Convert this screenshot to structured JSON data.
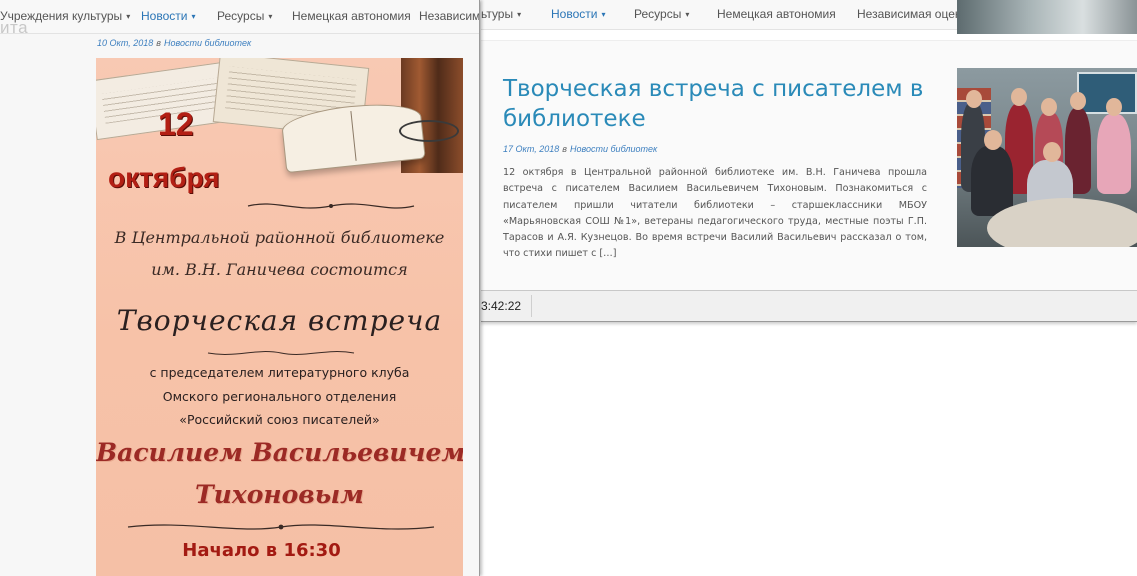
{
  "left_window": {
    "nav": [
      {
        "label": "Учреждения культуры",
        "caret": "▾",
        "active": false
      },
      {
        "label": "Новости",
        "caret": "▾",
        "active": true
      },
      {
        "label": "Ресурсы",
        "caret": "▾",
        "active": false
      },
      {
        "label": "Немецкая автономия",
        "caret": "",
        "active": false
      },
      {
        "label": "Независим",
        "caret": "",
        "active": false
      }
    ],
    "ghost_text": "ита",
    "post_meta": {
      "date": "10 Окт, 2018",
      "sep": "в",
      "category": "Новости библиотек"
    },
    "poster": {
      "day": "12",
      "month": "октября",
      "line1": "В Центральной районной библиотеке",
      "line2": "им. В.Н. Ганичева состоится",
      "title": "Творческая встреча",
      "sub1": "с председателем литературного клуба",
      "sub2": "Омского регионального отделения",
      "sub3": "«Российский союз писателей»",
      "name1": "Василием Васильевичем",
      "name2": "Тихоновым",
      "start": "Начало в 16:30"
    }
  },
  "right_window": {
    "nav": [
      {
        "label": "ьтуры",
        "caret": "▾",
        "active": false
      },
      {
        "label": "Новости",
        "caret": "▾",
        "active": true
      },
      {
        "label": "Ресурсы",
        "caret": "▾",
        "active": false
      },
      {
        "label": "Немецкая автономия",
        "caret": "",
        "active": false
      },
      {
        "label": "Независимая оценка",
        "caret": "▾",
        "active": false
      }
    ],
    "post": {
      "title": "Творческая встреча с писателем в библиотеке",
      "meta": {
        "date": "17 Окт, 2018",
        "sep": "в",
        "category": "Новости библиотек"
      },
      "excerpt": "12 октября в Центральной районной библиотеке им. В.Н. Ганичева прошла встреча с писателем Василием Васильевичем Тихоновым. Познакомиться с писателем пришли читатели библиотеки – старшеклассники МБОУ «Марьяновская СОШ №1», ветераны педагогического труда, местные поэты Г.П. Тарасов и А.Я. Кузнецов. Во время встречи Василий Васильевич рассказал о том, что стихи пишет с […]"
    },
    "status_time": "3:42:22"
  },
  "colors": {
    "link": "#2a8ab8",
    "nav_active": "#2a75b6",
    "poster_bg": "#f7c2a8",
    "poster_red": "#b31f14"
  }
}
